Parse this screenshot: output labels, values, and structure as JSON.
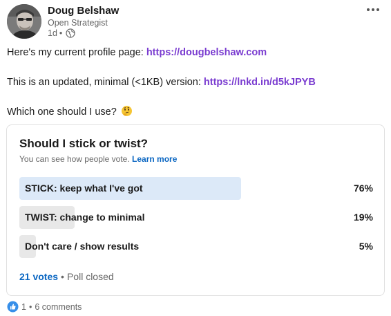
{
  "author": {
    "name": "Doug Belshaw",
    "headline": "Open Strategist",
    "time": "1d",
    "separator": "•"
  },
  "post": {
    "line1_text": "Here's my current profile page: ",
    "line1_link": "https://dougbelshaw.com",
    "line2_text": "This is an updated, minimal (<1KB) version: ",
    "line2_link": "https://lnkd.in/d5kJPYB",
    "line3_text": "Which one should I use?",
    "line3_emoji": "thinking-face-icon"
  },
  "poll": {
    "question": "Should I stick or twist?",
    "note": "You can see how people vote.",
    "learn_more": "Learn more",
    "options": [
      {
        "label": "STICK: keep what I've got",
        "percent_label": "76%",
        "percent": 76,
        "leading": true
      },
      {
        "label": "TWIST: change to minimal",
        "percent_label": "19%",
        "percent": 19,
        "leading": false
      },
      {
        "label": "Don't care / show results",
        "percent_label": "5%",
        "percent": 5,
        "leading": false
      }
    ],
    "votes": "21 votes",
    "separator": "•",
    "status": "Poll closed"
  },
  "social": {
    "reactions": "1",
    "separator": "•",
    "comments": "6 comments"
  },
  "colors": {
    "link_purple": "#7a3cd0",
    "link_blue": "#0a66c2",
    "leading_bar": "#dce9f8",
    "bar": "#e8e8e8"
  }
}
